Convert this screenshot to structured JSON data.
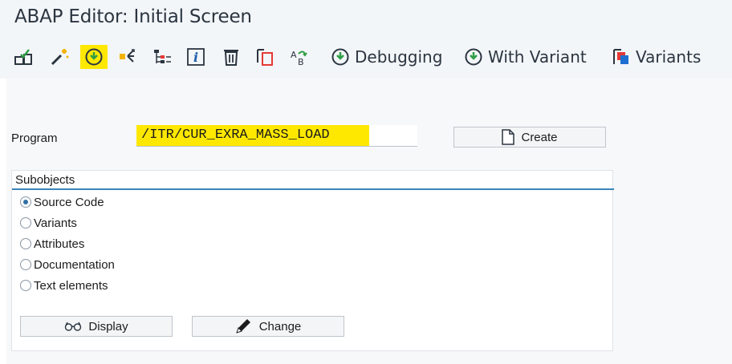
{
  "window": {
    "title": "ABAP Editor: Initial Screen"
  },
  "toolbar": {
    "icons": [
      "check-object-icon",
      "activate-icon",
      "execute-icon",
      "where-used-icon",
      "object-list-icon",
      "info-icon",
      "delete-icon",
      "copy-icon",
      "rename-icon"
    ],
    "debugging_label": "Debugging",
    "with_variant_label": "With Variant",
    "variants_label": "Variants"
  },
  "program": {
    "label": "Program",
    "value": "/ITR/CUR_EXRA_MASS_LOAD",
    "create_label": "Create"
  },
  "subobjects": {
    "title": "Subobjects",
    "options": [
      {
        "label": "Source Code",
        "selected": true
      },
      {
        "label": "Variants",
        "selected": false
      },
      {
        "label": "Attributes",
        "selected": false
      },
      {
        "label": "Documentation",
        "selected": false
      },
      {
        "label": "Text elements",
        "selected": false
      }
    ],
    "display_label": "Display",
    "change_label": "Change"
  },
  "colors": {
    "highlight": "#ffe800",
    "accent": "#3b84b7",
    "toolbar_bg": "#f3f6f9"
  }
}
